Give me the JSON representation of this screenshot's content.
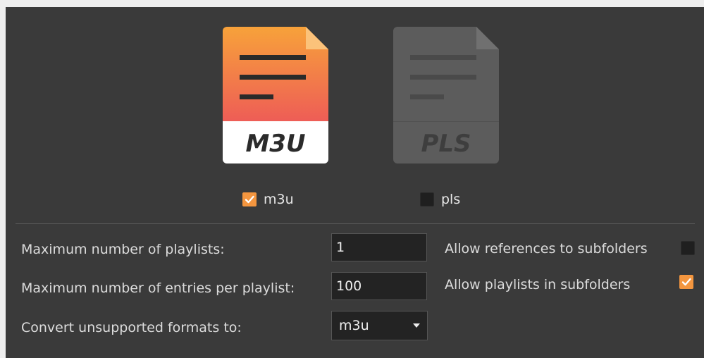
{
  "formats": {
    "m3u": {
      "icon_caption": "M3U",
      "checkbox_label": "m3u",
      "checked": true,
      "icon": "document-lines-icon",
      "gradient": [
        "#f7a23a",
        "#ee5d56"
      ]
    },
    "pls": {
      "icon_caption": "PLS",
      "checkbox_label": "pls",
      "checked": false,
      "icon": "document-lines-icon",
      "color": "#5c5c5c"
    }
  },
  "settings": {
    "max_playlists": {
      "label": "Maximum number of playlists:",
      "value": "1"
    },
    "max_entries": {
      "label": "Maximum number of entries per playlist:",
      "value": "100"
    },
    "convert_formats": {
      "label": "Convert unsupported formats to:",
      "selected": "m3u"
    },
    "allow_references": {
      "label": "Allow references to subfolders",
      "checked": false
    },
    "allow_playlists": {
      "label": "Allow playlists in subfolders",
      "checked": true
    }
  },
  "colors": {
    "accent": "#f4963f",
    "panel_background": "#3a3a3a",
    "field_background": "#232323"
  }
}
